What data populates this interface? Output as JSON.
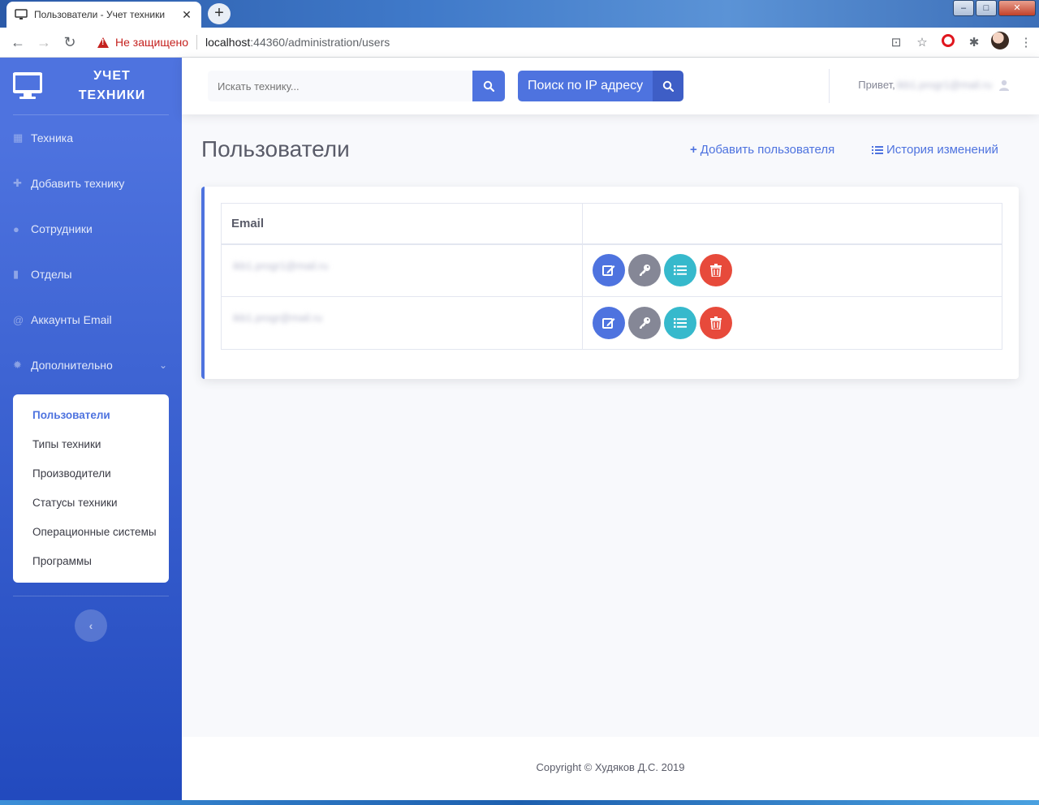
{
  "browser": {
    "tab_title": "Пользователи - Учет техники",
    "tab_close": "✕",
    "new_tab": "+",
    "security_label": "Не защищено",
    "url_host": "localhost",
    "url_rest": ":44360/administration/users"
  },
  "sidebar": {
    "brand_line1": "Учет",
    "brand_line2": "техники",
    "items": [
      {
        "label": "Техника",
        "icon": "table-icon"
      },
      {
        "label": "Добавить технику",
        "icon": "plus-icon"
      },
      {
        "label": "Сотрудники",
        "icon": "user-icon"
      },
      {
        "label": "Отделы",
        "icon": "building-icon"
      },
      {
        "label": "Аккаунты Email",
        "icon": "at-icon"
      },
      {
        "label": "Дополнительно",
        "icon": "gear-icon"
      }
    ],
    "submenu": [
      {
        "label": "Пользователи",
        "active": true
      },
      {
        "label": "Типы техники"
      },
      {
        "label": "Производители"
      },
      {
        "label": "Статусы техники"
      },
      {
        "label": "Операционные системы"
      },
      {
        "label": "Программы"
      }
    ]
  },
  "topbar": {
    "search_placeholder": "Искать технику...",
    "ip_search_label": "Поиск по IP адресу",
    "greeting": "Привет,",
    "user_email": "ikb1.progr1@mail.ru"
  },
  "main": {
    "title": "Пользователи",
    "add_user": "Добавить пользователя",
    "history": "История изменений",
    "table": {
      "header_email": "Email",
      "rows": [
        {
          "email": "ikb1.progr1@mail.ru"
        },
        {
          "email": "ikb1.progr@mail.ru"
        }
      ]
    }
  },
  "footer": {
    "copyright": "Copyright © Худяков Д.С. 2019"
  },
  "colors": {
    "primary": "#4e73df",
    "secondary": "#858796",
    "info": "#36b9cc",
    "danger": "#e74a3b"
  }
}
